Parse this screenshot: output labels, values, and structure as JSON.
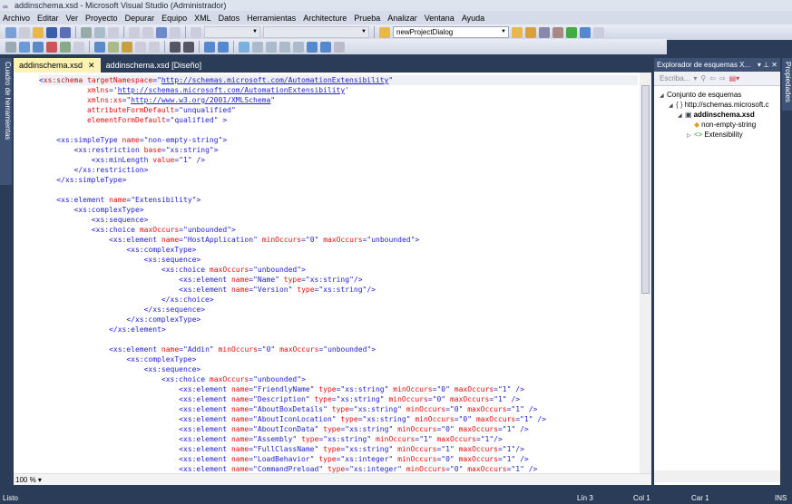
{
  "window": {
    "title": "addinschema.xsd - Microsoft Visual Studio (Administrador)"
  },
  "menu": [
    "Archivo",
    "Editar",
    "Ver",
    "Proyecto",
    "Depurar",
    "Equipo",
    "XML",
    "Datos",
    "Herramientas",
    "Architecture",
    "Prueba",
    "Analizar",
    "Ventana",
    "Ayuda"
  ],
  "toolbar": {
    "find_combo": "newProjectDialog"
  },
  "left_strip": "Cuadro de herramientas",
  "right_strip": "Propiedades",
  "tabs": [
    {
      "label": "addinschema.xsd",
      "active": true
    },
    {
      "label": "addinschema.xsd [Diseño]",
      "active": false
    }
  ],
  "editor": {
    "zoom": "100 %",
    "lines": [
      "<xs:schema targetNamespace=\"http://schemas.microsoft.com/AutomationExtensibility\"",
      "           xmlns='http://schemas.microsoft.com/AutomationExtensibility'",
      "           xmlns:xs=\"http://www.w3.org/2001/XMLSchema\"",
      "           attributeFormDefault=\"unqualified\"",
      "           elementFormDefault=\"qualified\" >",
      "",
      "    <xs:simpleType name=\"non-empty-string\">",
      "        <xs:restriction base=\"xs:string\">",
      "            <xs:minLength value=\"1\" />",
      "        </xs:restriction>",
      "    </xs:simpleType>",
      "",
      "    <xs:element name=\"Extensibility\">",
      "        <xs:complexType>",
      "            <xs:sequence>",
      "            <xs:choice maxOccurs=\"unbounded\">",
      "                <xs:element name=\"HostApplication\" minOccurs=\"0\" maxOccurs=\"unbounded\">",
      "                    <xs:complexType>",
      "                        <xs:sequence>",
      "                            <xs:choice maxOccurs=\"unbounded\">",
      "                                <xs:element name=\"Name\" type=\"xs:string\"/>",
      "                                <xs:element name=\"Version\" type=\"xs:string\"/>",
      "                            </xs:choice>",
      "                        </xs:sequence>",
      "                    </xs:complexType>",
      "                </xs:element>",
      "",
      "                <xs:element name=\"Addin\" minOccurs=\"0\" maxOccurs=\"unbounded\">",
      "                    <xs:complexType>",
      "                        <xs:sequence>",
      "                            <xs:choice maxOccurs=\"unbounded\">",
      "                                <xs:element name=\"FriendlyName\" type=\"xs:string\" minOccurs=\"0\" maxOccurs=\"1\" />",
      "                                <xs:element name=\"Description\" type=\"xs:string\" minOccurs=\"0\" maxOccurs=\"1\" />",
      "                                <xs:element name=\"AboutBoxDetails\" type=\"xs:string\" minOccurs=\"0\" maxOccurs=\"1\" />",
      "                                <xs:element name=\"AboutIconLocation\" type=\"xs:string\" minOccurs=\"0\" maxOccurs=\"1\" />",
      "                                <xs:element name=\"AboutIconData\" type=\"xs:string\" minOccurs=\"0\" maxOccurs=\"1\" />",
      "                                <xs:element name=\"Assembly\" type=\"xs:string\" minOccurs=\"1\" maxOccurs=\"1\"/>",
      "                                <xs:element name=\"FullClassName\" type=\"xs:string\" minOccurs=\"1\" maxOccurs=\"1\"/>",
      "                                <xs:element name=\"LoadBehavior\" type=\"xs:integer\" minOccurs=\"0\" maxOccurs=\"1\" />",
      "                                <xs:element name=\"CommandPreload\" type=\"xs:integer\" minOccurs=\"0\" maxOccurs=\"1\" />"
    ]
  },
  "schema_explorer": {
    "title": "Explorador de esquemas X...",
    "search_placeholder": "Escriba...",
    "tree": [
      {
        "label": "Conjunto de esquemas",
        "level": 0,
        "expander": "◢"
      },
      {
        "label": "http://schemas.microsoft.c",
        "level": 1,
        "expander": "◢",
        "icon": "{ }"
      },
      {
        "label": "addinschema.xsd",
        "level": 2,
        "expander": "◢",
        "icon": "▣",
        "bold": true
      },
      {
        "label": "non-empty-string",
        "level": 3,
        "expander": "",
        "icon": "◆"
      },
      {
        "label": "Extensibility",
        "level": 3,
        "expander": "▷",
        "icon": "<>"
      }
    ]
  },
  "status": {
    "text": "Listo",
    "line": "Lín 3",
    "col": "Col 1",
    "car": "Car 1",
    "mode": "INS"
  }
}
